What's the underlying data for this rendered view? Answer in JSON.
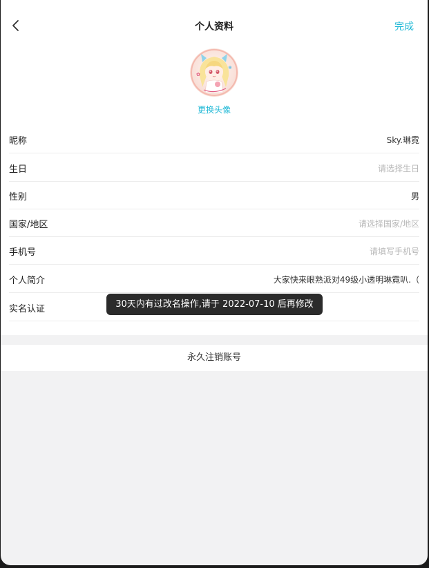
{
  "header": {
    "title": "个人资料",
    "done_label": "完成"
  },
  "avatar": {
    "change_label": "更换头像"
  },
  "fields": [
    {
      "label": "昵称",
      "value": "Sky.琳霓",
      "placeholder": false
    },
    {
      "label": "生日",
      "value": "请选择生日",
      "placeholder": true
    },
    {
      "label": "性别",
      "value": "男",
      "placeholder": false
    },
    {
      "label": "国家/地区",
      "value": "请选择国家/地区",
      "placeholder": true
    },
    {
      "label": "手机号",
      "value": "请填写手机号",
      "placeholder": true
    },
    {
      "label": "个人简介",
      "value": "大家快来眼熟派对49级小透明琳霓叭.（",
      "placeholder": false
    },
    {
      "label": "实名认证",
      "value": "",
      "placeholder": false
    }
  ],
  "delete_account_label": "永久注销账号",
  "toast": "30天内有过改名操作,请于 2022-07-10 后再修改",
  "colors": {
    "accent": "#1fb8d6",
    "toast_bg": "#2b2b2b",
    "page_bg": "#f2f2f3"
  },
  "icons": {
    "back": "chevron-left-icon"
  }
}
